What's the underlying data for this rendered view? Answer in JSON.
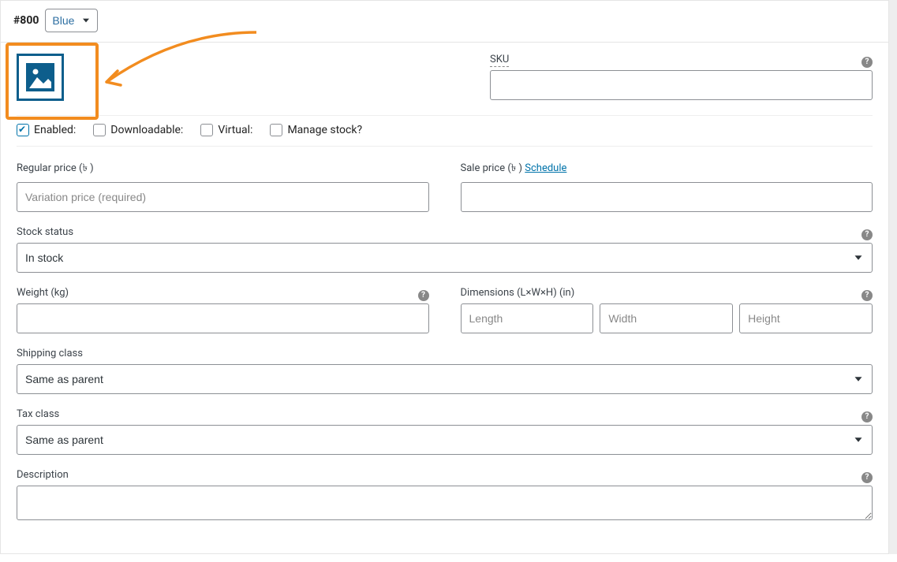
{
  "variation": {
    "id": "#800",
    "attribute_options": [
      "Blue"
    ],
    "attribute_selected": "Blue"
  },
  "sku": {
    "label": "SKU",
    "value": ""
  },
  "checkboxes": {
    "enabled": {
      "label": "Enabled:",
      "checked": true
    },
    "downloadable": {
      "label": "Downloadable:",
      "checked": false
    },
    "virtual": {
      "label": "Virtual:",
      "checked": false
    },
    "manage_stock": {
      "label": "Manage stock?",
      "checked": false
    }
  },
  "regular_price": {
    "label": "Regular price (৳ )",
    "placeholder": "Variation price (required)",
    "value": ""
  },
  "sale_price": {
    "label": "Sale price (৳ ) ",
    "schedule_text": "Schedule",
    "value": ""
  },
  "stock_status": {
    "label": "Stock status",
    "options": [
      "In stock"
    ],
    "selected": "In stock"
  },
  "weight": {
    "label": "Weight (kg)",
    "value": ""
  },
  "dimensions": {
    "label": "Dimensions (L×W×H) (in)",
    "length_placeholder": "Length",
    "width_placeholder": "Width",
    "height_placeholder": "Height",
    "length": "",
    "width": "",
    "height": ""
  },
  "shipping_class": {
    "label": "Shipping class",
    "options": [
      "Same as parent"
    ],
    "selected": "Same as parent"
  },
  "tax_class": {
    "label": "Tax class",
    "options": [
      "Same as parent"
    ],
    "selected": "Same as parent"
  },
  "description": {
    "label": "Description",
    "value": ""
  }
}
